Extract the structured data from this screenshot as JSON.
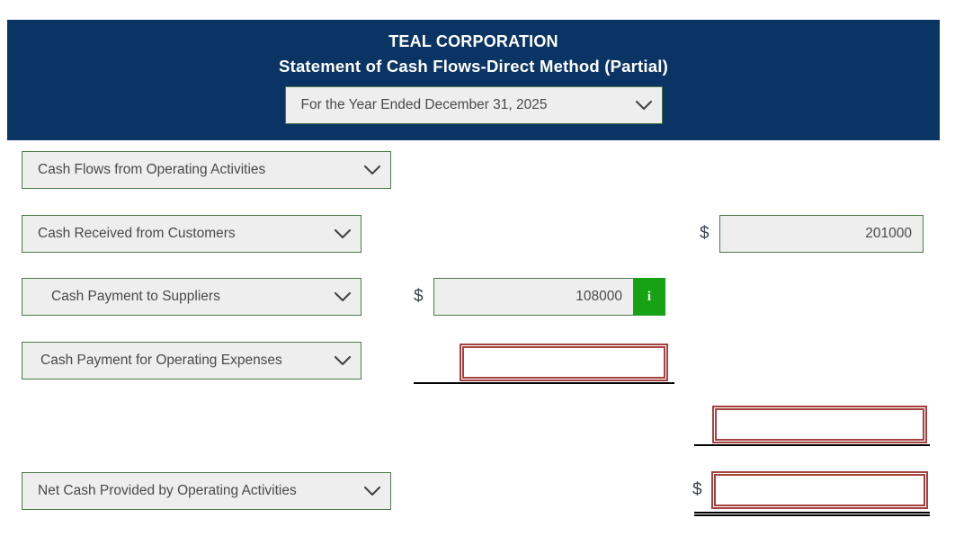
{
  "header": {
    "company": "TEAL CORPORATION",
    "statement_title": "Statement of Cash Flows-Direct Method (Partial)",
    "period_select": {
      "value": "For the Year Ended December 31, 2025",
      "icon": "chevron-down-icon"
    },
    "background_color": "#0a3464",
    "text_color": "#ffffff"
  },
  "colors": {
    "navy": "#0a3464",
    "select_border": "#4a7a48",
    "select_bg": "#eeeeee",
    "error_border": "#a3423f",
    "info_green": "#17a215",
    "rule": "#000000"
  },
  "rows": [
    {
      "label": "Cash Flows from Operating Activities",
      "icon": "chevron-down-icon"
    },
    {
      "label": "Cash Received from Customers",
      "icon": "chevron-down-icon",
      "right_dollar": "$",
      "right_value": "201000"
    },
    {
      "label": "Cash Payment to Suppliers",
      "icon": "chevron-down-icon",
      "mid_dollar": "$",
      "mid_value": "108000",
      "info_label": "i"
    },
    {
      "label": "Cash Payment for Operating Expenses",
      "icon": "chevron-down-icon",
      "mid_value": "",
      "mid_placeholder": ""
    },
    {
      "right_value": "",
      "right_placeholder": ""
    },
    {
      "label": "Net Cash Provided by Operating Activities",
      "icon": "chevron-down-icon",
      "right_dollar": "$",
      "right_value": "",
      "right_placeholder": ""
    }
  ]
}
